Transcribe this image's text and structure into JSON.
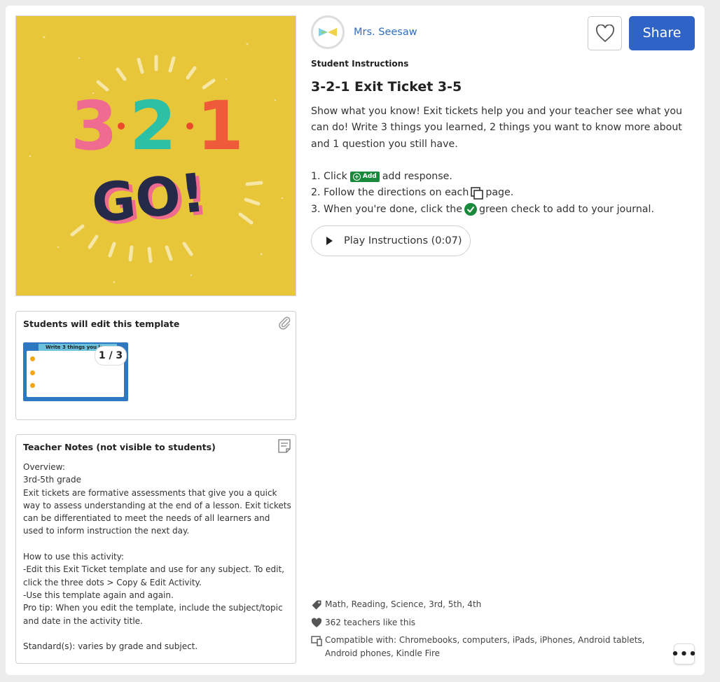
{
  "teacher": {
    "name": "Mrs. Seesaw"
  },
  "header": {
    "share_label": "Share"
  },
  "hero": {
    "big_text": "3·2·1",
    "go_text": "GO!"
  },
  "template_panel": {
    "title": "Students will edit this template",
    "thumb_header": "Write 3 things you learned",
    "page_badge": "1 / 3"
  },
  "notes_panel": {
    "title": "Teacher Notes (not visible to students)",
    "body": "Overview:\n3rd-5th grade\nExit tickets are formative assessments that give you a quick way to assess understanding at the end of a lesson. Exit tickets can be differentiated to meet the needs of all learners and used to inform instruction the next day.\n\nHow to use this activity:\n-Edit this Exit Ticket template and use for any subject. To edit, click the three dots > Copy & Edit Activity.\n-Use this template again and again.\nPro tip: When you edit the template, include the subject/topic and date in the activity title.\n\nStandard(s): varies by grade and subject."
  },
  "activity": {
    "section_label": "Student Instructions",
    "title": "3-2-1 Exit Ticket 3-5",
    "description": "Show what you know! Exit tickets help you and your teacher see what you can do! Write 3 things you learned, 2 things you want to know more about and 1 question you still have.",
    "steps": {
      "s1_prefix": "1. Click",
      "s1_chip": "Add",
      "s1_suffix": "add response.",
      "s2_prefix": "2. Follow the directions on each",
      "s2_suffix": "page.",
      "s3_prefix": "3. When you're done, click the",
      "s3_suffix": "green check to add to your journal."
    },
    "play_label": "Play Instructions (0:07)"
  },
  "meta": {
    "tags": "Math, Reading, Science, 3rd, 5th, 4th",
    "likes": "362 teachers like this",
    "compatible": "Compatible with: Chromebooks, computers, iPads, iPhones, Android tablets, Android phones, Kindle Fire"
  },
  "colors": {
    "accent": "#2f63c6",
    "link": "#2f6ec4",
    "hero_bg": "#e7c63a",
    "green": "#198a3c"
  }
}
